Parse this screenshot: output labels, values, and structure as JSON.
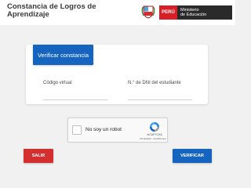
{
  "header": {
    "title": "Constancia de Logros de Aprendizaje",
    "country_label": "PERÚ",
    "ministry_label": "Ministerio\nde Educación"
  },
  "form": {
    "tab_label": "Verificar constancia",
    "code_label": "Código virtual",
    "code_value": "",
    "dni_label": "N.° de DNI del estudiante",
    "dni_value": ""
  },
  "captcha": {
    "label": "No soy un robot",
    "brand": "reCAPTCHA",
    "links": "Privacidad - Condiciones",
    "checked": false
  },
  "actions": {
    "exit_label": "SALIR",
    "verify_label": "VERIFICAR"
  },
  "colors": {
    "primary": "#1565c0",
    "danger": "#d32f2f",
    "peru_red": "#d81f26",
    "ministry_dark": "#2a2a2a"
  }
}
